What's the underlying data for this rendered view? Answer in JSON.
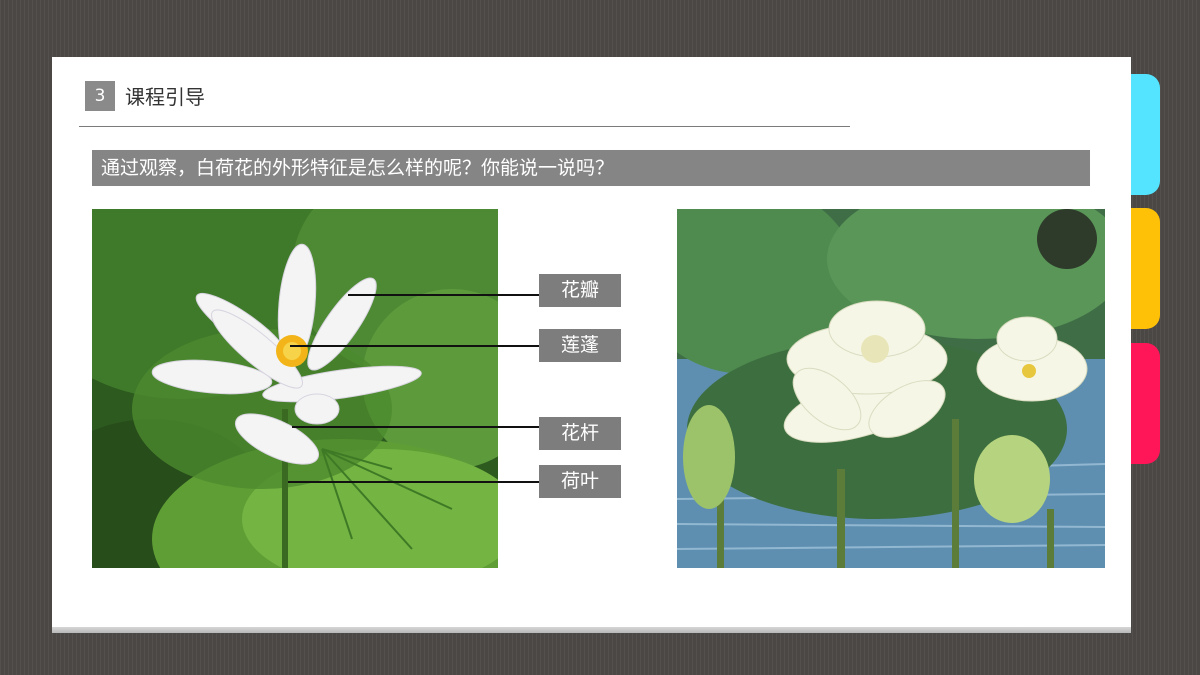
{
  "section": {
    "number": "3",
    "title": "课程引导"
  },
  "question": "通过观察，白荷花的外形特征是怎么样的呢？你能说一说吗？",
  "labels": [
    {
      "id": "petal",
      "text": "花瓣"
    },
    {
      "id": "seedpod",
      "text": "莲蓬"
    },
    {
      "id": "stem",
      "text": "花杆"
    },
    {
      "id": "leaf",
      "text": "荷叶"
    }
  ],
  "colors": {
    "background": "#4a4744",
    "tab_cyan": "#55e4ff",
    "tab_yellow": "#ffc107",
    "tab_red": "#ff1658",
    "bar_gray": "#858585"
  }
}
